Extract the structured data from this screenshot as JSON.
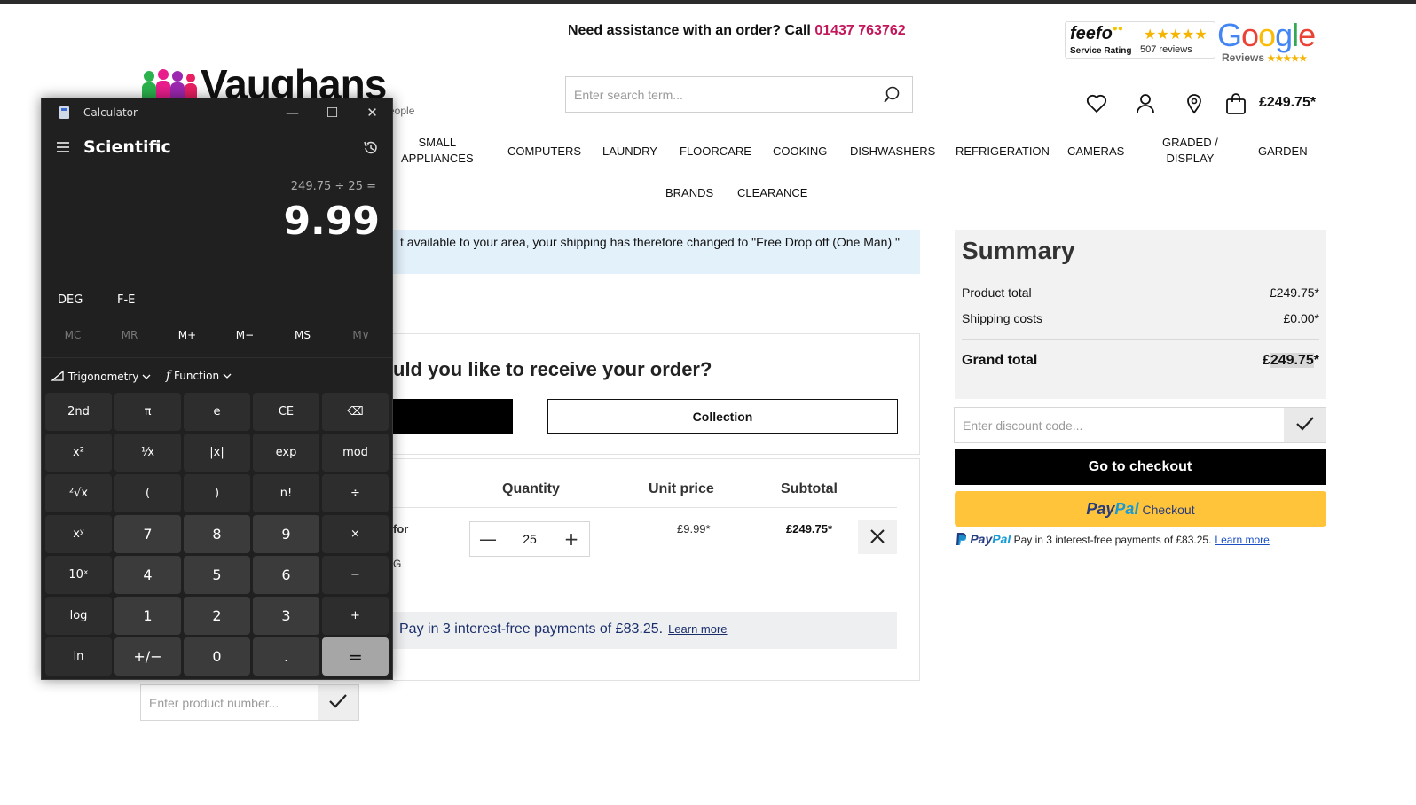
{
  "header": {
    "assist_text": "Need assistance with an order? Call ",
    "phone": "01437 763762",
    "logo_word": "Vaughans",
    "logo_tag": "eople",
    "search_placeholder": "Enter search term...",
    "basket_total": "£249.75*"
  },
  "feefo": {
    "brand": "feefo",
    "service": "Service Rating",
    "stars": "★★★★★",
    "reviews": "507 reviews"
  },
  "google": {
    "word": "Google",
    "sub": "Reviews",
    "stars": "★★★★★"
  },
  "nav": [
    [
      "SMALL",
      "APPLIANCES"
    ],
    [
      "COMPUTERS"
    ],
    [
      "LAUNDRY"
    ],
    [
      "FLOORCARE"
    ],
    [
      "COOKING"
    ],
    [
      "DISHWASHERS"
    ],
    [
      "REFRIGERATION"
    ],
    [
      "CAMERAS"
    ],
    [
      "GRADED /",
      "DISPLAY"
    ],
    [
      "GARDEN"
    ],
    [
      "BRANDS"
    ],
    [
      "CLEARANCE"
    ]
  ],
  "notice": "t available to your area, your shipping has therefore changed to \"Free Drop off (One Man) \"",
  "delivery": {
    "question": "uld you like to receive your order?",
    "collection": "Collection"
  },
  "cart": {
    "headers": {
      "quantity": "Quantity",
      "unit_price": "Unit price",
      "subtotal": "Subtotal"
    },
    "frag1": "for",
    "frag2": "G",
    "quantity": "25",
    "unit_price": "£9.99*",
    "subtotal": "£249.75*",
    "paylater": "Pay in 3 interest-free payments of £83.25.",
    "learn_more": "Learn more"
  },
  "product_number_placeholder": "Enter product number...",
  "summary": {
    "title": "Summary",
    "product_total_label": "Product total",
    "product_total": "£249.75*",
    "shipping_label": "Shipping costs",
    "shipping": "£0.00*",
    "grand_label": "Grand total",
    "grand_prefix": "£",
    "grand_highlight": "249.75",
    "grand_suffix": "*",
    "discount_placeholder": "Enter discount code...",
    "checkout": "Go to checkout",
    "paypal_pay": "Pay",
    "paypal_pal": "Pal",
    "paypal_checkout": "Checkout",
    "paylater": "Pay in 3 interest-free payments of £83.25.",
    "learn_more": "Learn more"
  },
  "calculator": {
    "title": "Calculator",
    "mode": "Scientific",
    "expression": "249.75 ÷ 25 =",
    "display": "9.99",
    "deg": "DEG",
    "fe": "F-E",
    "memory": [
      "MC",
      "MR",
      "M+",
      "M−",
      "MS",
      "M∨"
    ],
    "trig": "Trigonometry",
    "func": "Function",
    "keys": [
      [
        "2nd",
        "π",
        "e",
        "CE",
        "⌫"
      ],
      [
        "x²",
        "¹⁄x",
        "|x|",
        "exp",
        "mod"
      ],
      [
        "²√x",
        "(",
        ")",
        "n!",
        "÷"
      ],
      [
        "xʸ",
        "7",
        "8",
        "9",
        "×"
      ],
      [
        "10ˣ",
        "4",
        "5",
        "6",
        "−"
      ],
      [
        "log",
        "1",
        "2",
        "3",
        "+"
      ],
      [
        "ln",
        "+/−",
        "0",
        ".",
        "="
      ]
    ]
  },
  "colors": {
    "accent_pink": "#c2185b",
    "paypal_yellow": "#ffc439",
    "calc_bg": "#202020"
  }
}
